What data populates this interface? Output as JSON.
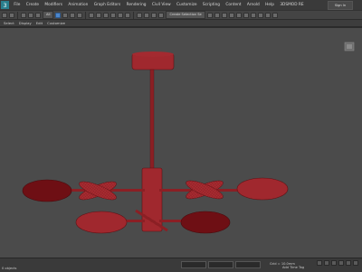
{
  "app": {
    "icon": "max-app-icon"
  },
  "menu": {
    "items": [
      "File",
      "Create",
      "Modifiers",
      "Animation",
      "Graph Editors",
      "Rendering",
      "Civil View",
      "Customize",
      "Scripting",
      "Content",
      "Arnold",
      "Help",
      "3DSMOD RE"
    ],
    "workspace_label": "Sign In"
  },
  "toolbar": {
    "selection_filter": "All",
    "named_selection": "Create Selection Se"
  },
  "ribbon": {
    "items": [
      "Select",
      "Display",
      "Edit",
      "Customize"
    ]
  },
  "viewport": {
    "background": "#4b4b4b",
    "model_color": "#8b1f24",
    "model_wire_color": "#c53a3f",
    "viewcube_icon": "viewcube-icon"
  },
  "status": {
    "left_text": "None Selected",
    "left_sub": "0 objects",
    "grid": "Grid = 10.0mm",
    "add_time_tag": "Add Time Tag"
  }
}
